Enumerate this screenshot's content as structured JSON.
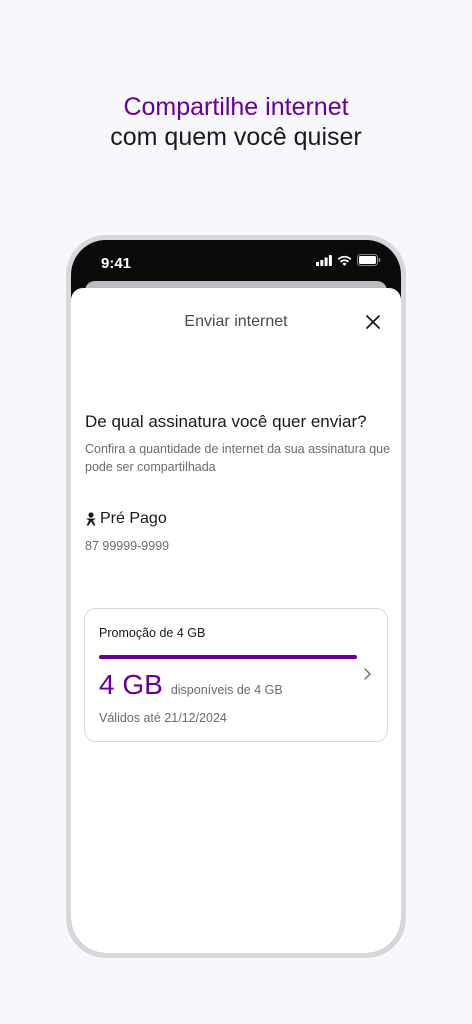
{
  "headline": {
    "line1": "Compartilhe internet",
    "line2": "com quem você quiser",
    "accent_color": "#660099"
  },
  "status_bar": {
    "time": "9:41",
    "icons": [
      "signal-icon",
      "wifi-icon",
      "battery-icon"
    ]
  },
  "sheet": {
    "title": "Enviar internet",
    "close_icon": "close-icon",
    "question": "De qual assinatura você quer enviar?",
    "subtext": "Confira a quantidade de internet da sua assinatura que pode ser compartilhada",
    "plan": {
      "icon": "person-icon",
      "name": "Pré Pago",
      "number": "87 99999-9999"
    },
    "card": {
      "title": "Promoção de 4 GB",
      "amount": "4 GB",
      "available_text": "disponíveis de 4 GB",
      "valid_until": "Válidos até 21/12/2024",
      "progress": 1.0,
      "chevron_icon": "chevron-right-icon"
    }
  }
}
